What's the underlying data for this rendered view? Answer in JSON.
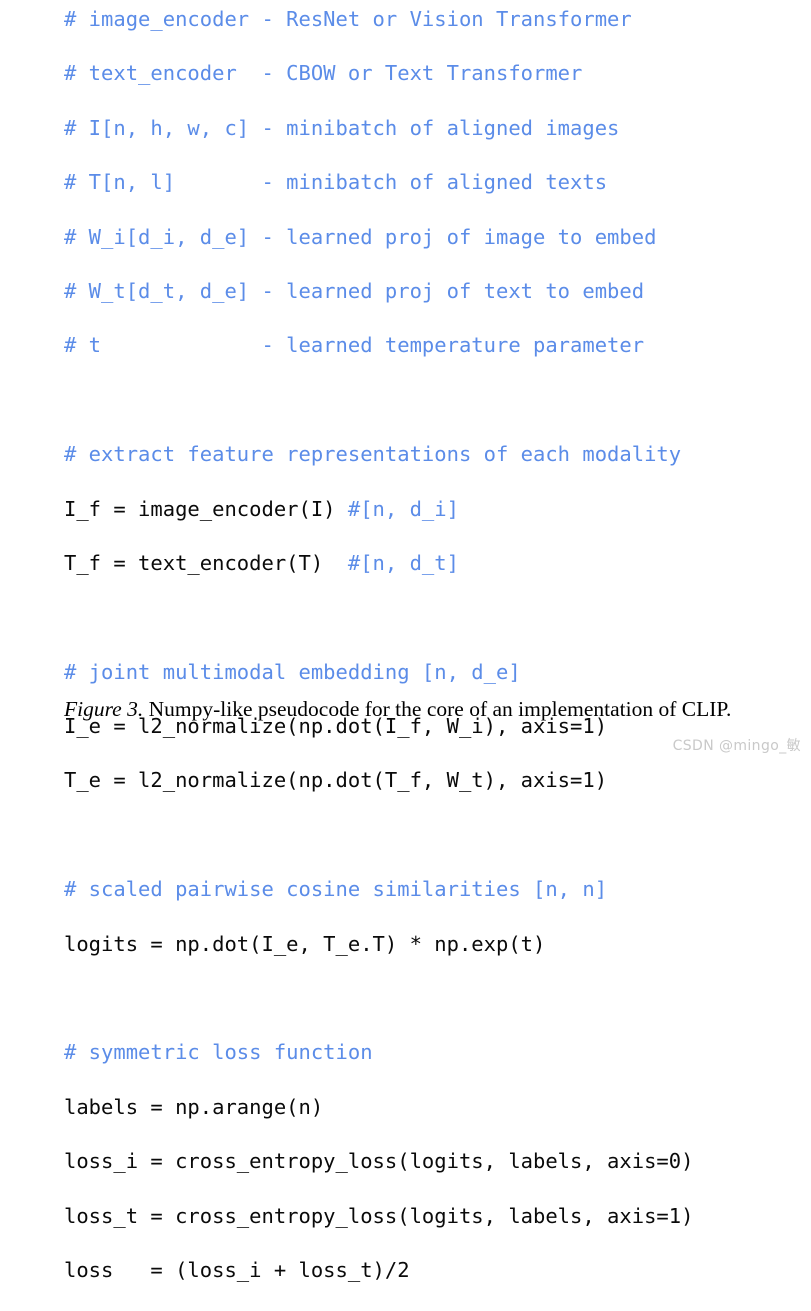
{
  "figure": {
    "background_color": "#ffffff",
    "comment_color": "#5b8ce8",
    "code_color": "#0a0a0a",
    "caption_color": "#000000",
    "watermark_color": "#c9c9c9"
  },
  "code": {
    "language": "numpy-like pseudocode",
    "lines": [
      {
        "kind": "comment",
        "text": "# image_encoder - ResNet or Vision Transformer"
      },
      {
        "kind": "comment",
        "text": "# text_encoder  - CBOW or Text Transformer"
      },
      {
        "kind": "comment",
        "text": "# I[n, h, w, c] - minibatch of aligned images"
      },
      {
        "kind": "comment",
        "text": "# T[n, l]       - minibatch of aligned texts"
      },
      {
        "kind": "comment",
        "text": "# W_i[d_i, d_e] - learned proj of image to embed"
      },
      {
        "kind": "comment",
        "text": "# W_t[d_t, d_e] - learned proj of text to embed"
      },
      {
        "kind": "comment",
        "text": "# t             - learned temperature parameter"
      },
      {
        "kind": "blank",
        "text": ""
      },
      {
        "kind": "comment",
        "text": "# extract feature representations of each modality"
      },
      {
        "kind": "mixed",
        "code": "I_f = image_encoder(I) ",
        "comment": "#[n, d_i]"
      },
      {
        "kind": "mixed",
        "code": "T_f = text_encoder(T)  ",
        "comment": "#[n, d_t]"
      },
      {
        "kind": "blank",
        "text": ""
      },
      {
        "kind": "comment",
        "text": "# joint multimodal embedding [n, d_e]"
      },
      {
        "kind": "code",
        "text": "I_e = l2_normalize(np.dot(I_f, W_i), axis=1)"
      },
      {
        "kind": "code",
        "text": "T_e = l2_normalize(np.dot(T_f, W_t), axis=1)"
      },
      {
        "kind": "blank",
        "text": ""
      },
      {
        "kind": "comment",
        "text": "# scaled pairwise cosine similarities [n, n]"
      },
      {
        "kind": "code",
        "text": "logits = np.dot(I_e, T_e.T) * np.exp(t)"
      },
      {
        "kind": "blank",
        "text": ""
      },
      {
        "kind": "comment",
        "text": "# symmetric loss function"
      },
      {
        "kind": "code",
        "text": "labels = np.arange(n)"
      },
      {
        "kind": "code",
        "text": "loss_i = cross_entropy_loss(logits, labels, axis=0)"
      },
      {
        "kind": "code",
        "text": "loss_t = cross_entropy_loss(logits, labels, axis=1)"
      },
      {
        "kind": "code",
        "text": "loss   = (loss_i + loss_t)/2"
      }
    ]
  },
  "caption": {
    "label": "Figure 3.",
    "body": " Numpy-like pseudocode for the core of an implementation of CLIP."
  },
  "watermark": {
    "text": "CSDN @mingo_敏"
  }
}
